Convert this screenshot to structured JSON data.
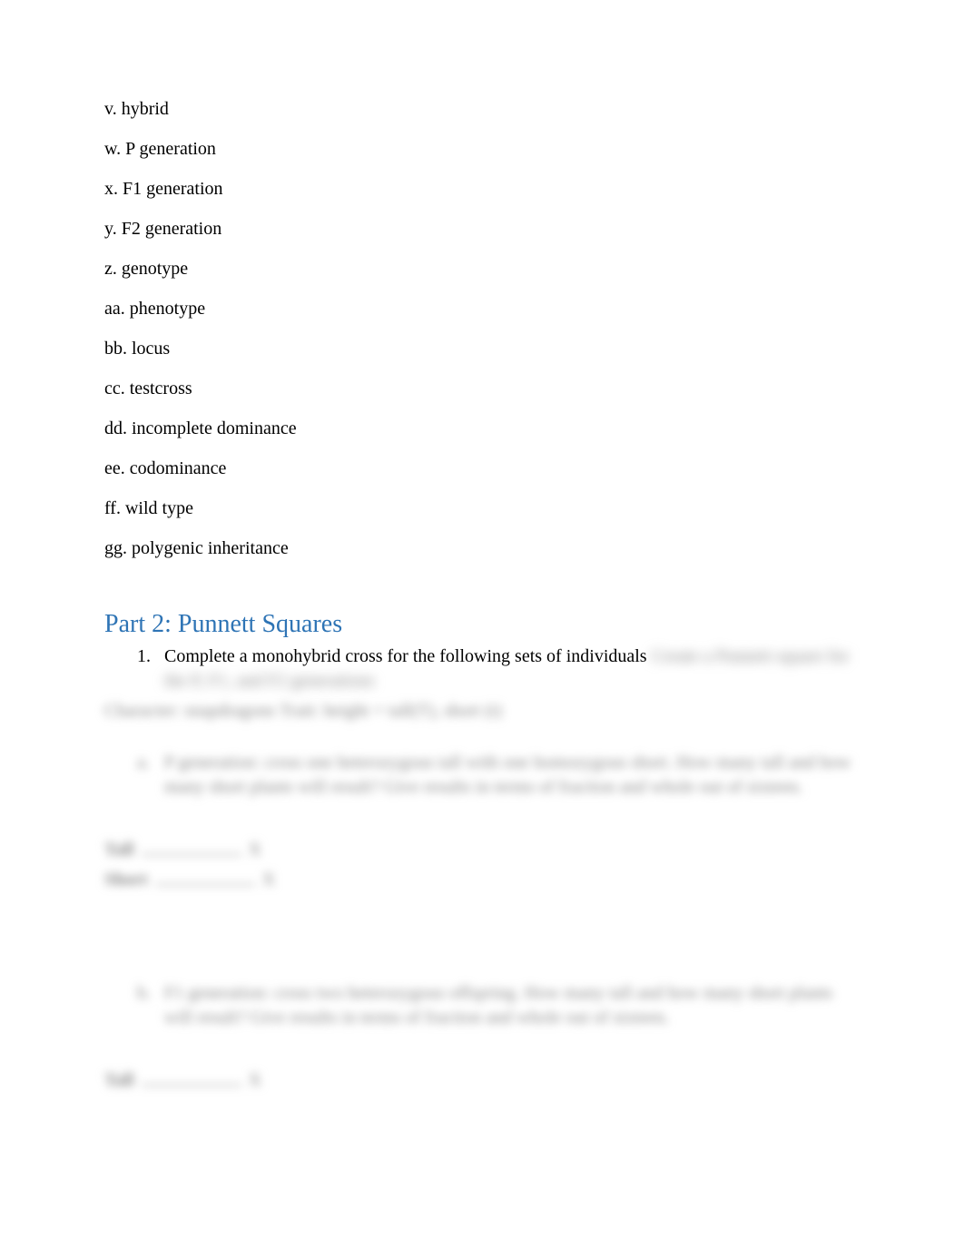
{
  "terms": {
    "v": "v. hybrid",
    "w": "w. P generation",
    "x": "x. F1 generation",
    "y": "y. F2 generation",
    "z": "z. genotype",
    "aa": "aa. phenotype",
    "bb": "bb. locus",
    "cc": "cc. testcross",
    "dd": "dd. incomplete dominance",
    "ee": "ee. codominance",
    "ff": "ff. wild type",
    "gg": "gg. polygenic inheritance"
  },
  "part2": {
    "heading": "Part 2: Punnett Squares",
    "q1": {
      "num": "1.",
      "visible_text": "Complete a monohybrid cross for the following sets of individuals",
      "blurred_tail": "  Create a Punnett square for the P, F1, and F2 generations"
    },
    "line_character_trait": "Character: snapdragons                         Trait: height = tall(T), short (t)",
    "sub_a": {
      "mark": "a.",
      "text": "P generation: cross one heterozygous tall with one homozygous short. How many tall and how many short plants will result? Give results in terms of fraction and whole out of sixteen."
    },
    "answers_a": {
      "tall_label": "Tall",
      "tall_x": "X",
      "short_label": "Short",
      "short_x": "X"
    },
    "sub_b": {
      "mark": "b.",
      "text": "F1 generation: cross two heterozygous offspring. How many tall and how many short plants will result? Give results in terms of fraction and whole out of sixteen."
    },
    "answers_b": {
      "tall_label": "Tall",
      "tall_x": "X"
    }
  }
}
